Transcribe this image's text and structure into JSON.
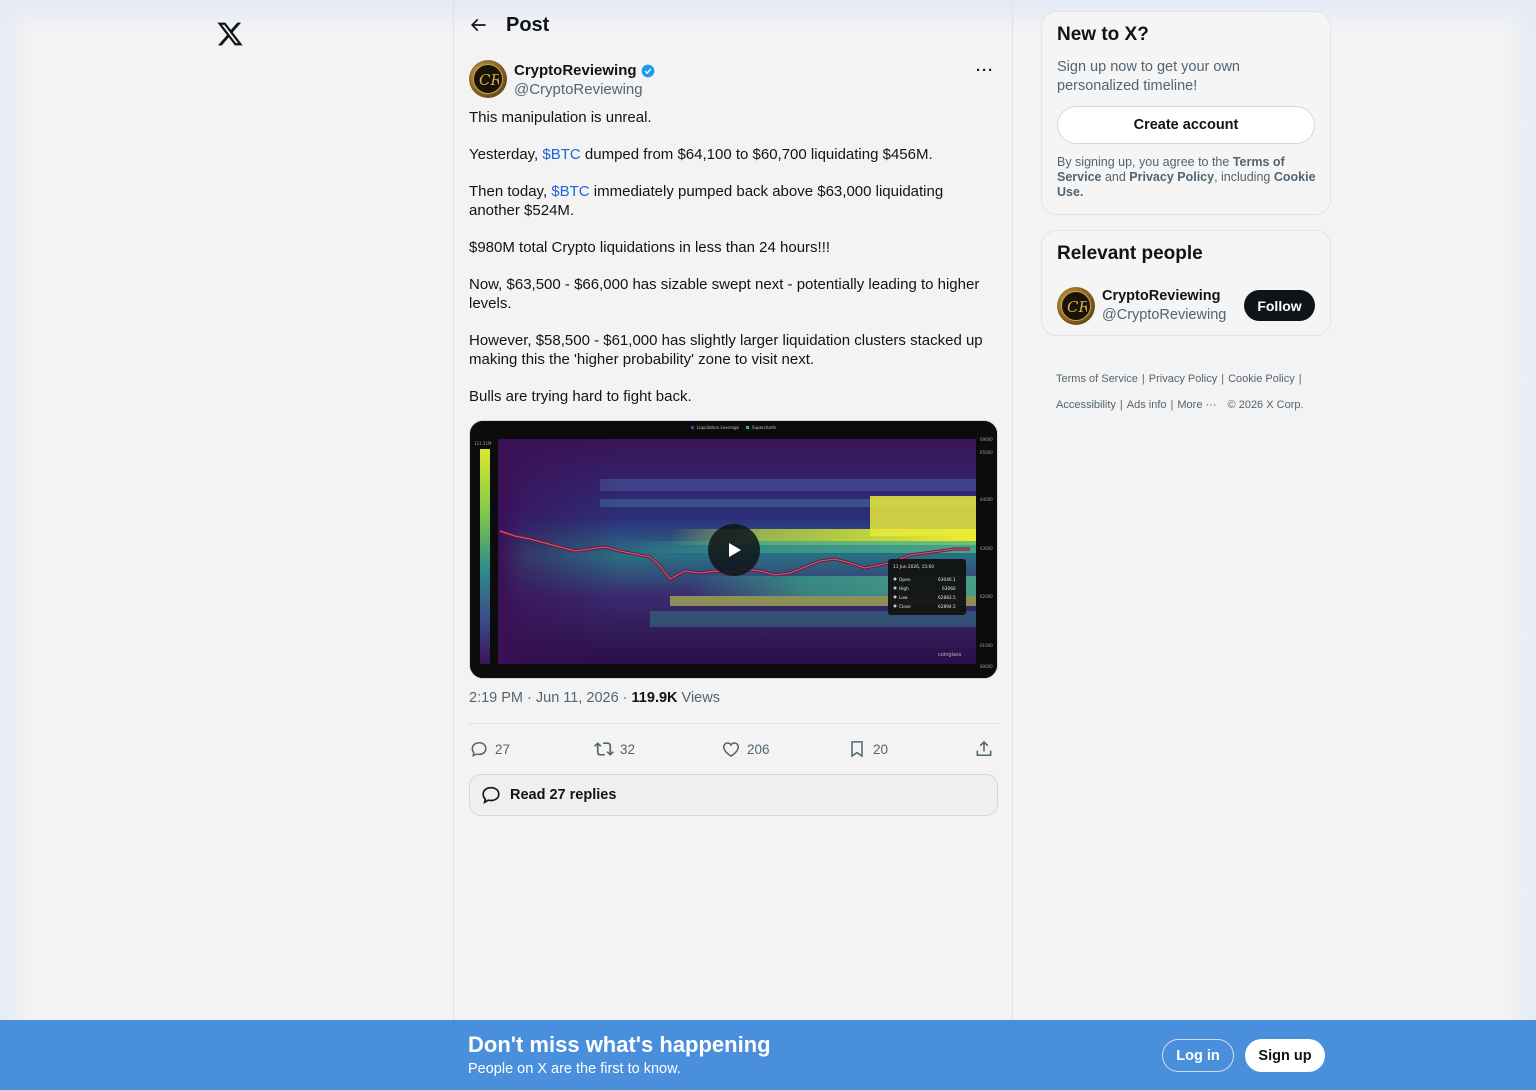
{
  "header": {
    "title": "Post"
  },
  "post": {
    "author_name": "CryptoReviewing",
    "author_handle": "@CryptoReviewing",
    "paragraphs": {
      "p1": "This manipulation is unreal.",
      "p2_before": "Yesterday, ",
      "p2_tag": "$BTC",
      "p2_after": " dumped from $64,100 to $60,700 liquidating $456M.",
      "p3_before": "Then today, ",
      "p3_tag": "$BTC",
      "p3_after": " immediately pumped back above $63,000 liquidating another $524M.",
      "p4": "$980M total Crypto liquidations in less than 24 hours!!!",
      "p5": "Now, $63,500 - $66,000 has sizable  swept next - potentially leading to higher levels.",
      "p6": "However, $58,500 - $61,000 has slightly larger liquidation clusters stacked up making this the 'higher probability' zone to visit next.",
      "p7": "Bulls are trying hard to fight back."
    },
    "media": {
      "legend_1": "Liquidation Leverage",
      "legend_2": "Supercharts",
      "scale_label": "121.51M",
      "watermark": "coinglass",
      "tooltip": {
        "date": "11 Jun 2026, 15:00",
        "open_label": "Open",
        "open_value": "63046.1",
        "high_label": "High",
        "high_value": "63060",
        "low_label": "Low",
        "low_value": "62883.5",
        "close_label": "Close",
        "close_value": "62894.5"
      },
      "y_ticks": [
        "69000",
        "65000",
        "64000",
        "63000",
        "62000",
        "61000",
        "60000"
      ]
    },
    "time": "2:19 PM · Jun 11, 2026 · ",
    "views_count": "119.9K",
    "views_label": " Views",
    "stats": {
      "replies": "27",
      "reposts": "32",
      "likes": "206",
      "bookmarks": "20"
    },
    "read_replies": "Read 27 replies"
  },
  "sidebar": {
    "new_title": "New to X?",
    "new_sub": "Sign up now to get your own personalized timeline!",
    "create_account": "Create account",
    "legal_1": "By signing up, you agree to the ",
    "legal_terms": "Terms of Service",
    "legal_2": " and ",
    "legal_privacy": "Privacy Policy",
    "legal_3": ", including ",
    "legal_cookie": "Cookie Use.",
    "people_title": "Relevant people",
    "people_name": "CryptoReviewing",
    "people_handle": "@CryptoReviewing",
    "follow": "Follow"
  },
  "footer": {
    "terms": "Terms of Service",
    "privacy": "Privacy Policy",
    "cookie": "Cookie Policy",
    "accessibility": "Accessibility",
    "ads": "Ads info",
    "more": "More ···",
    "copyright": "© 2026 X Corp."
  },
  "bottom_bar": {
    "title": "Don't miss what's happening",
    "subtitle": "People on X are the first to know.",
    "login": "Log in",
    "signup": "Sign up"
  },
  "colors": {
    "accent": "#1d9bf0",
    "bottom_bar": "#4a8fdc",
    "cashtag": "#1d64d8"
  }
}
